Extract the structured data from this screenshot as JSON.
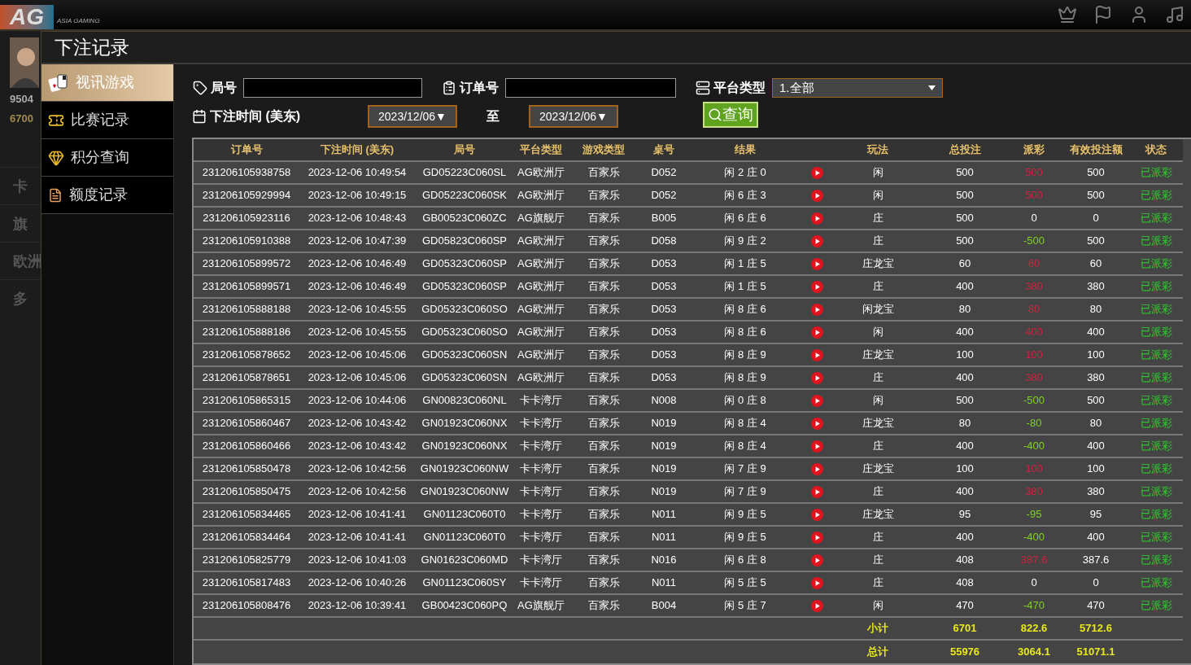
{
  "app": {
    "logo": "AG",
    "tagline": "ASIA GAMING"
  },
  "lobby": {
    "balances": [
      "9504",
      "6700"
    ],
    "categories": [
      "卡",
      "旗",
      "欧洲",
      "多"
    ]
  },
  "dialog": {
    "title": "下注记录",
    "sidebar": [
      {
        "label": "视讯游戏",
        "kind": "cards",
        "selected": true
      },
      {
        "label": "比赛记录",
        "kind": "ticket",
        "selected": false
      },
      {
        "label": "积分查询",
        "kind": "gem",
        "selected": false
      },
      {
        "label": "额度记录",
        "kind": "document",
        "selected": false
      }
    ],
    "filters": {
      "round_label": "局号",
      "order_label": "订单号",
      "platform_label": "平台类型",
      "platform_value": "1.全部",
      "time_label": "下注时间 (美东)",
      "date_from": "2023/12/06▼",
      "to_label": "至",
      "date_to": "2023/12/06▼",
      "query_button": "查询"
    },
    "table": {
      "columns": [
        "订单号",
        "下注时间 (美东)",
        "局号",
        "平台类型",
        "游戏类型",
        "桌号",
        "结果",
        "玩法",
        "总投注",
        "派彩",
        "有效投注额",
        "状态"
      ],
      "rows": [
        {
          "order": "231206105938758",
          "time": "2023-12-06 10:49:54",
          "round": "GD05223C060SL",
          "platform": "AG欧洲厅",
          "game": "百家乐",
          "table": "D052",
          "result": "闲 2 庄 0",
          "bet": "闲",
          "total": "500",
          "payout": "500",
          "color": "#d0213f",
          "valid": "500",
          "status": "已派彩"
        },
        {
          "order": "231206105929994",
          "time": "2023-12-06 10:49:15",
          "round": "GD05223C060SK",
          "platform": "AG欧洲厅",
          "game": "百家乐",
          "table": "D052",
          "result": "闲 6 庄 3",
          "bet": "闲",
          "total": "500",
          "payout": "500",
          "color": "#d0213f",
          "valid": "500",
          "status": "已派彩"
        },
        {
          "order": "231206105923116",
          "time": "2023-12-06 10:48:43",
          "round": "GB00523C060ZC",
          "platform": "AG旗舰厅",
          "game": "百家乐",
          "table": "B005",
          "result": "闲 6 庄 6",
          "bet": "庄",
          "total": "500",
          "payout": "0",
          "color": "#ffffff",
          "valid": "0",
          "status": "已派彩"
        },
        {
          "order": "231206105910388",
          "time": "2023-12-06 10:47:39",
          "round": "GD05823C060SP",
          "platform": "AG欧洲厅",
          "game": "百家乐",
          "table": "D058",
          "result": "闲 9 庄 2",
          "bet": "庄",
          "total": "500",
          "payout": "-500",
          "color": "#7ed321",
          "valid": "500",
          "status": "已派彩"
        },
        {
          "order": "231206105899572",
          "time": "2023-12-06 10:46:49",
          "round": "GD05323C060SP",
          "platform": "AG欧洲厅",
          "game": "百家乐",
          "table": "D053",
          "result": "闲 1 庄 5",
          "bet": "庄龙宝",
          "total": "60",
          "payout": "60",
          "color": "#d0213f",
          "valid": "60",
          "status": "已派彩"
        },
        {
          "order": "231206105899571",
          "time": "2023-12-06 10:46:49",
          "round": "GD05323C060SP",
          "platform": "AG欧洲厅",
          "game": "百家乐",
          "table": "D053",
          "result": "闲 1 庄 5",
          "bet": "庄",
          "total": "400",
          "payout": "380",
          "color": "#d0213f",
          "valid": "380",
          "status": "已派彩"
        },
        {
          "order": "231206105888188",
          "time": "2023-12-06 10:45:55",
          "round": "GD05323C060SO",
          "platform": "AG欧洲厅",
          "game": "百家乐",
          "table": "D053",
          "result": "闲 8 庄 6",
          "bet": "闲龙宝",
          "total": "80",
          "payout": "80",
          "color": "#d0213f",
          "valid": "80",
          "status": "已派彩"
        },
        {
          "order": "231206105888186",
          "time": "2023-12-06 10:45:55",
          "round": "GD05323C060SO",
          "platform": "AG欧洲厅",
          "game": "百家乐",
          "table": "D053",
          "result": "闲 8 庄 6",
          "bet": "闲",
          "total": "400",
          "payout": "400",
          "color": "#d0213f",
          "valid": "400",
          "status": "已派彩"
        },
        {
          "order": "231206105878652",
          "time": "2023-12-06 10:45:06",
          "round": "GD05323C060SN",
          "platform": "AG欧洲厅",
          "game": "百家乐",
          "table": "D053",
          "result": "闲 8 庄 9",
          "bet": "庄龙宝",
          "total": "100",
          "payout": "100",
          "color": "#d0213f",
          "valid": "100",
          "status": "已派彩"
        },
        {
          "order": "231206105878651",
          "time": "2023-12-06 10:45:06",
          "round": "GD05323C060SN",
          "platform": "AG欧洲厅",
          "game": "百家乐",
          "table": "D053",
          "result": "闲 8 庄 9",
          "bet": "庄",
          "total": "400",
          "payout": "380",
          "color": "#d0213f",
          "valid": "380",
          "status": "已派彩"
        },
        {
          "order": "231206105865315",
          "time": "2023-12-06 10:44:06",
          "round": "GN00823C060NL",
          "platform": "卡卡湾厅",
          "game": "百家乐",
          "table": "N008",
          "result": "闲 0 庄 8",
          "bet": "闲",
          "total": "500",
          "payout": "-500",
          "color": "#7ed321",
          "valid": "500",
          "status": "已派彩"
        },
        {
          "order": "231206105860467",
          "time": "2023-12-06 10:43:42",
          "round": "GN01923C060NX",
          "platform": "卡卡湾厅",
          "game": "百家乐",
          "table": "N019",
          "result": "闲 8 庄 4",
          "bet": "庄龙宝",
          "total": "80",
          "payout": "-80",
          "color": "#7ed321",
          "valid": "80",
          "status": "已派彩"
        },
        {
          "order": "231206105860466",
          "time": "2023-12-06 10:43:42",
          "round": "GN01923C060NX",
          "platform": "卡卡湾厅",
          "game": "百家乐",
          "table": "N019",
          "result": "闲 8 庄 4",
          "bet": "庄",
          "total": "400",
          "payout": "-400",
          "color": "#7ed321",
          "valid": "400",
          "status": "已派彩"
        },
        {
          "order": "231206105850478",
          "time": "2023-12-06 10:42:56",
          "round": "GN01923C060NW",
          "platform": "卡卡湾厅",
          "game": "百家乐",
          "table": "N019",
          "result": "闲 7 庄 9",
          "bet": "庄龙宝",
          "total": "100",
          "payout": "100",
          "color": "#d0213f",
          "valid": "100",
          "status": "已派彩"
        },
        {
          "order": "231206105850475",
          "time": "2023-12-06 10:42:56",
          "round": "GN01923C060NW",
          "platform": "卡卡湾厅",
          "game": "百家乐",
          "table": "N019",
          "result": "闲 7 庄 9",
          "bet": "庄",
          "total": "400",
          "payout": "380",
          "color": "#d0213f",
          "valid": "380",
          "status": "已派彩"
        },
        {
          "order": "231206105834465",
          "time": "2023-12-06 10:41:41",
          "round": "GN01123C060T0",
          "platform": "卡卡湾厅",
          "game": "百家乐",
          "table": "N011",
          "result": "闲 9 庄 5",
          "bet": "庄龙宝",
          "total": "95",
          "payout": "-95",
          "color": "#7ed321",
          "valid": "95",
          "status": "已派彩"
        },
        {
          "order": "231206105834464",
          "time": "2023-12-06 10:41:41",
          "round": "GN01123C060T0",
          "platform": "卡卡湾厅",
          "game": "百家乐",
          "table": "N011",
          "result": "闲 9 庄 5",
          "bet": "庄",
          "total": "400",
          "payout": "-400",
          "color": "#7ed321",
          "valid": "400",
          "status": "已派彩"
        },
        {
          "order": "231206105825779",
          "time": "2023-12-06 10:41:03",
          "round": "GN01623C060MD",
          "platform": "卡卡湾厅",
          "game": "百家乐",
          "table": "N016",
          "result": "闲 6 庄 8",
          "bet": "庄",
          "total": "408",
          "payout": "387.6",
          "color": "#d0213f",
          "valid": "387.6",
          "status": "已派彩"
        },
        {
          "order": "231206105817483",
          "time": "2023-12-06 10:40:26",
          "round": "GN01123C060SY",
          "platform": "卡卡湾厅",
          "game": "百家乐",
          "table": "N011",
          "result": "闲 5 庄 5",
          "bet": "庄",
          "total": "408",
          "payout": "0",
          "color": "#ffffff",
          "valid": "0",
          "status": "已派彩"
        },
        {
          "order": "231206105808476",
          "time": "2023-12-06 10:39:41",
          "round": "GB00423C060PQ",
          "platform": "AG旗舰厅",
          "game": "百家乐",
          "table": "B004",
          "result": "闲 5 庄 7",
          "bet": "闲",
          "total": "470",
          "payout": "-470",
          "color": "#7ed321",
          "valid": "470",
          "status": "已派彩"
        }
      ],
      "summary": [
        {
          "label": "小计",
          "total": "6701",
          "payout": "822.6",
          "valid": "5712.6"
        },
        {
          "label": "总计",
          "total": "55976",
          "payout": "3064.1",
          "valid": "51071.1"
        }
      ]
    }
  }
}
